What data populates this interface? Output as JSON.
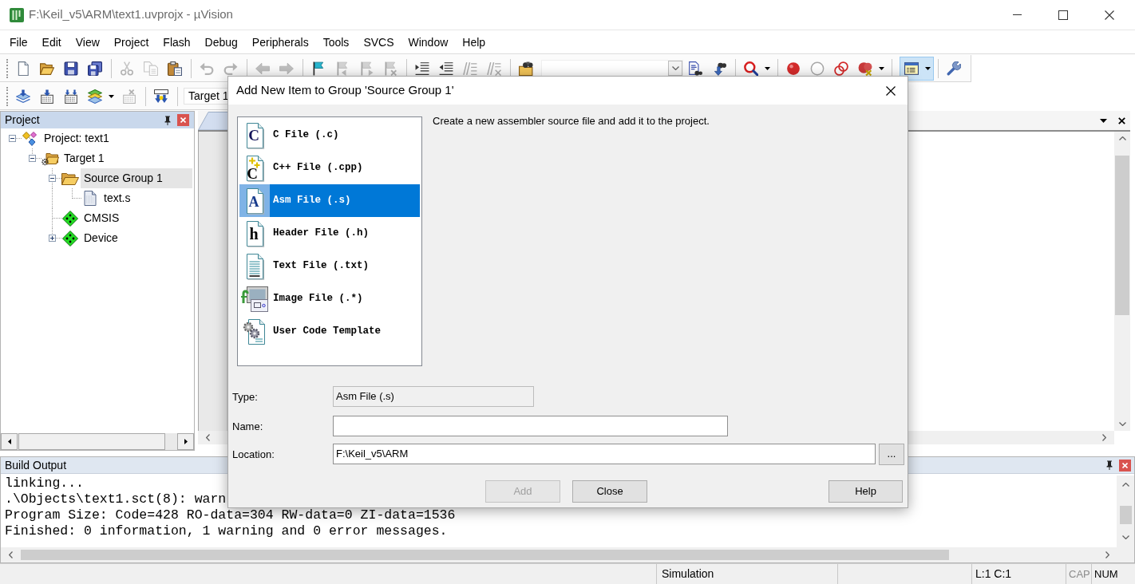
{
  "window": {
    "title": "F:\\Keil_v5\\ARM\\text1.uvprojx - µVision"
  },
  "menu": [
    "File",
    "Edit",
    "View",
    "Project",
    "Flash",
    "Debug",
    "Peripherals",
    "Tools",
    "SVCS",
    "Window",
    "Help"
  ],
  "toolbar_1": [
    {
      "kind": "button",
      "disabled": false,
      "pressed": false
    },
    {
      "kind": "button",
      "disabled": false,
      "pressed": false
    },
    {
      "kind": "button",
      "disabled": false,
      "pressed": false
    },
    {
      "kind": "button",
      "disabled": false,
      "pressed": false
    },
    {
      "kind": "separator"
    },
    {
      "kind": "button",
      "disabled": true,
      "pressed": false
    },
    {
      "kind": "button",
      "disabled": true,
      "pressed": false
    },
    {
      "kind": "button",
      "disabled": false,
      "pressed": false
    },
    {
      "kind": "separator"
    },
    {
      "kind": "button",
      "disabled": true,
      "pressed": false
    },
    {
      "kind": "button",
      "disabled": true,
      "pressed": false
    },
    {
      "kind": "separator"
    },
    {
      "kind": "button",
      "disabled": true,
      "pressed": false
    },
    {
      "kind": "button",
      "disabled": true,
      "pressed": false
    },
    {
      "kind": "separator"
    },
    {
      "kind": "button",
      "disabled": false,
      "pressed": false
    },
    {
      "kind": "button",
      "disabled": true,
      "pressed": false
    },
    {
      "kind": "button",
      "disabled": true,
      "pressed": false
    },
    {
      "kind": "button",
      "disabled": true,
      "pressed": false
    },
    {
      "kind": "separator"
    },
    {
      "kind": "button",
      "disabled": false,
      "pressed": false
    },
    {
      "kind": "button",
      "disabled": false,
      "pressed": false
    },
    {
      "kind": "button",
      "disabled": true,
      "pressed": false
    },
    {
      "kind": "button",
      "disabled": true,
      "pressed": false
    },
    {
      "kind": "separator"
    },
    {
      "kind": "button",
      "disabled": false,
      "pressed": false
    },
    {
      "kind": "combo"
    },
    {
      "kind": "button",
      "disabled": false,
      "pressed": false
    },
    {
      "kind": "button",
      "disabled": false,
      "pressed": false
    },
    {
      "kind": "separator"
    },
    {
      "kind": "split",
      "disabled": false,
      "pressed": false
    },
    {
      "kind": "separator"
    },
    {
      "kind": "button",
      "disabled": false,
      "pressed": false
    },
    {
      "kind": "button",
      "disabled": false,
      "pressed": false
    },
    {
      "kind": "button",
      "disabled": false,
      "pressed": false
    },
    {
      "kind": "split",
      "disabled": false,
      "pressed": false
    },
    {
      "kind": "separator"
    },
    {
      "kind": "split",
      "disabled": false,
      "pressed": true
    },
    {
      "kind": "separator"
    },
    {
      "kind": "button",
      "disabled": false,
      "pressed": false
    }
  ],
  "toolbar_2": [
    {
      "kind": "button",
      "disabled": false,
      "pressed": false
    },
    {
      "kind": "button",
      "disabled": false,
      "pressed": false
    },
    {
      "kind": "button",
      "disabled": false,
      "pressed": false
    },
    {
      "kind": "split",
      "disabled": false,
      "pressed": false
    },
    {
      "kind": "button",
      "disabled": true,
      "pressed": false
    },
    {
      "kind": "separator"
    },
    {
      "kind": "button",
      "disabled": false,
      "pressed": false
    },
    {
      "kind": "separator"
    },
    {
      "kind": "combo",
      "value": "Target 1"
    }
  ],
  "project_panel": {
    "title": "Project",
    "tree": [
      {
        "kind": "project",
        "label": "Project: text1",
        "expanded": true,
        "selected": false,
        "children": [
          {
            "kind": "target",
            "label": "Target 1",
            "expanded": true,
            "selected": false,
            "children": [
              {
                "kind": "group",
                "label": "Source Group 1",
                "expanded": true,
                "selected": true,
                "children": [
                  {
                    "kind": "file",
                    "label": "text.s",
                    "selected": false
                  }
                ]
              },
              {
                "kind": "component",
                "label": "CMSIS",
                "selected": false
              },
              {
                "kind": "component",
                "label": "Device",
                "expanded": false,
                "selected": false
              }
            ]
          }
        ]
      }
    ]
  },
  "build_output": {
    "title": "Build Output",
    "lines": [
      "linking...",
      ".\\Objects\\text1.sct(8): warn",
      "Program Size: Code=428 RO-data=304 RW-data=0 ZI-data=1536",
      "Finished: 0 information, 1 warning and 0 error messages."
    ]
  },
  "status_bar": {
    "mode": "Simulation",
    "cursor": "L:1 C:1",
    "indicators": [
      {
        "label": "CAP",
        "on": false
      },
      {
        "label": "NUM",
        "on": true
      }
    ]
  },
  "dialog": {
    "title": "Add New Item to Group 'Source Group 1'",
    "items": [
      {
        "kind": "c",
        "icon_letter": "C",
        "label": "C File (.c)",
        "selected": false
      },
      {
        "kind": "cpp",
        "icon_letter": "C",
        "label": "C++ File (.cpp)",
        "selected": false
      },
      {
        "kind": "asm",
        "icon_letter": "A",
        "label": "Asm File (.s)",
        "selected": true
      },
      {
        "kind": "header",
        "icon_letter": "h",
        "label": "Header File (.h)",
        "selected": false
      },
      {
        "kind": "text",
        "label": "Text File (.txt)",
        "selected": false
      },
      {
        "kind": "image",
        "label": "Image File (.*)",
        "selected": false
      },
      {
        "kind": "template",
        "label": "User Code Template",
        "selected": false
      }
    ],
    "description": "Create a new assembler source file and add it to the project.",
    "fields": [
      {
        "label": "Type:",
        "value": "Asm File (.s)",
        "read_only": true
      },
      {
        "label": "Name:",
        "read_only": false
      },
      {
        "label": "Location:",
        "value": "F:\\Keil_v5\\ARM",
        "read_only": false,
        "browse": "..."
      }
    ],
    "buttons": [
      {
        "label": "Add",
        "disabled": true
      },
      {
        "label": "Close",
        "disabled": false
      },
      {
        "label": "Help",
        "disabled": false
      }
    ]
  }
}
